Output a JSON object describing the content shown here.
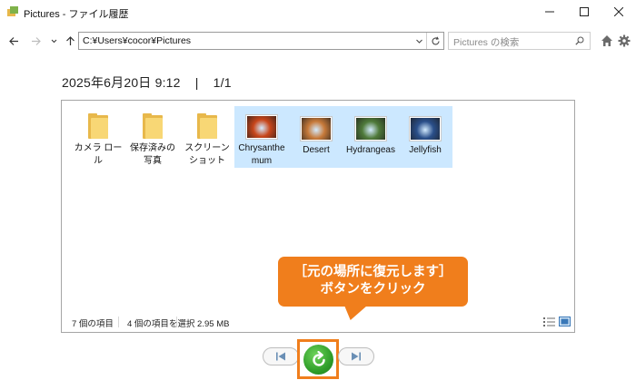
{
  "window": {
    "title": "Pictures - ファイル履歴"
  },
  "navigation": {
    "address": "C:¥Users¥cocor¥Pictures",
    "search_placeholder": "Pictures の検索"
  },
  "version": {
    "date": "2025年6月20日 9:12",
    "separator": "|",
    "index": "1/1"
  },
  "items": [
    {
      "label": "カメラ ロール",
      "type": "folder",
      "selected": false
    },
    {
      "label": "保存済みの写真",
      "type": "folder",
      "selected": false
    },
    {
      "label": "スクリーンショット",
      "type": "folder",
      "selected": false
    },
    {
      "label": "Chrysanthemum",
      "type": "image",
      "selected": true,
      "color": "#c8461a"
    },
    {
      "label": "Desert",
      "type": "image",
      "selected": true,
      "color": "#c77a3a"
    },
    {
      "label": "Hydrangeas",
      "type": "image",
      "selected": true,
      "color": "#4f7a3a"
    },
    {
      "label": "Jellyfish",
      "type": "image",
      "selected": true,
      "color": "#2a4f8a"
    }
  ],
  "status": {
    "item_count": "7 個の項目",
    "selection": "4 個の項目を選択  2.95 MB"
  },
  "callout": {
    "line1": "［元の場所に復元します］",
    "line2": "ボタンをクリック"
  },
  "colors": {
    "accent": "#f07e1c",
    "selection": "#cce8ff",
    "restore": "#2f9e2a"
  }
}
